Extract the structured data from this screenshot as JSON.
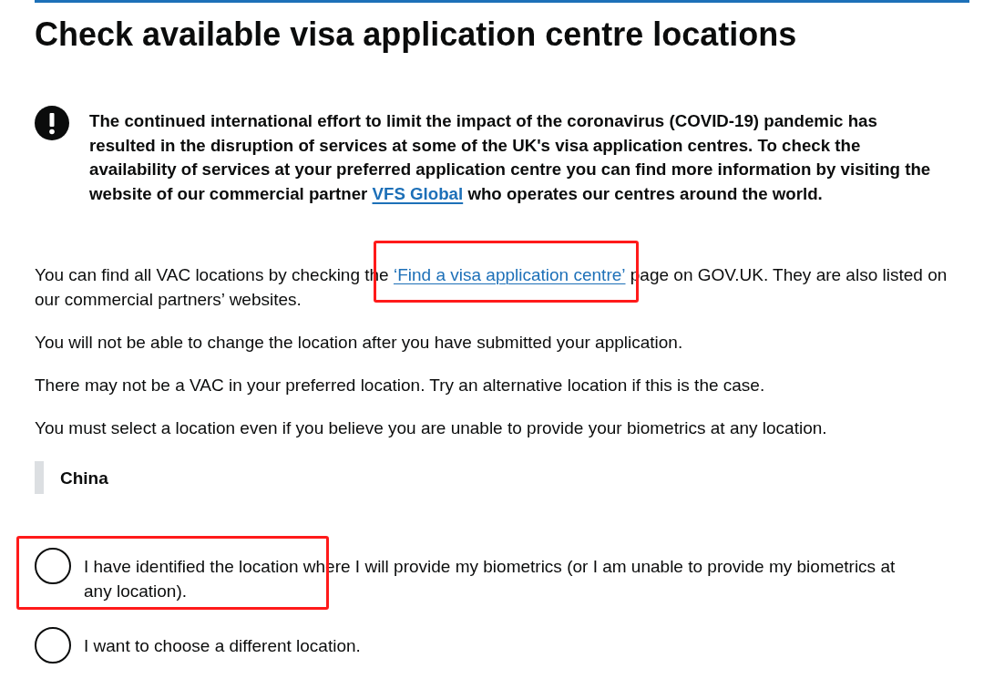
{
  "header": {
    "title": "Check available visa application centre locations"
  },
  "warning": {
    "parts": [
      {
        "kind": "text",
        "text": "The continued international effort to limit the impact of the coronavirus (COVID-19) pandemic has resulted in the disruption of services at some of the UK's visa application centres. To check the availability of services at your preferred application centre you can find more information by visiting the website of our commercial partner "
      },
      {
        "kind": "link",
        "text": "VFS Global",
        "annotated": false
      },
      {
        "kind": "text",
        "text": " who operates our centres around the world."
      }
    ]
  },
  "paragraphs": [
    {
      "parts": [
        {
          "kind": "text",
          "text": "You can find all VAC locations by checking the "
        },
        {
          "kind": "link",
          "text": "‘Find a visa application centre’",
          "annotated": true
        },
        {
          "kind": "text",
          "text": " page on GOV.UK. They are also listed on our commercial partners’ websites."
        }
      ]
    },
    {
      "parts": [
        {
          "kind": "text",
          "text": "You will not be able to change the location after you have submitted your application."
        }
      ]
    },
    {
      "parts": [
        {
          "kind": "text",
          "text": "There may not be a VAC in your preferred location. Try an alternative location if this is the case."
        }
      ]
    },
    {
      "parts": [
        {
          "kind": "text",
          "text": "You must select a location even if you believe you are unable to provide your biometrics at any location."
        }
      ]
    }
  ],
  "location": {
    "label": "China"
  },
  "options": [
    {
      "label": "I have identified the location where I will provide my biometrics (or I am unable to provide my biometrics at any location).",
      "selected": false,
      "annotated": true
    },
    {
      "label": "I want to choose a different location.",
      "selected": false,
      "annotated": false
    }
  ]
}
